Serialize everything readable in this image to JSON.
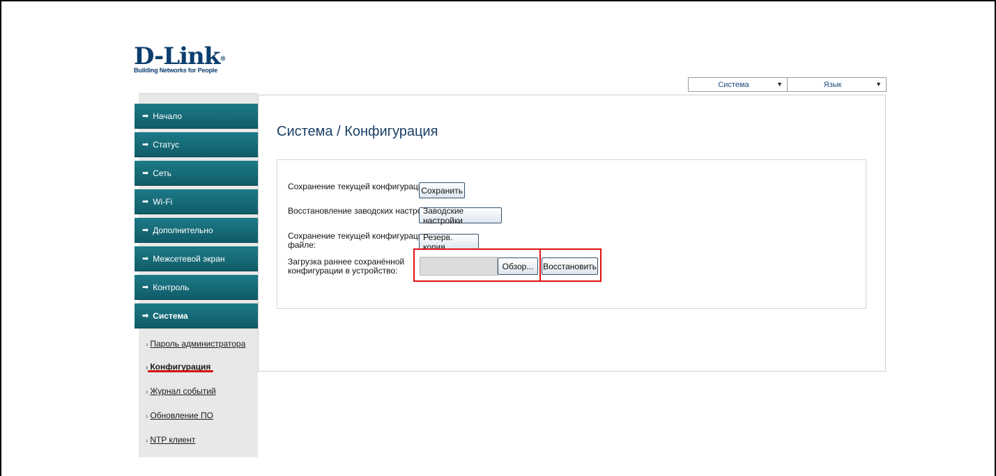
{
  "brand": {
    "name": "D-Link",
    "tagline": "Building Networks for People",
    "registered": "®"
  },
  "top_selects": [
    {
      "label": "Система",
      "arrow": "▼"
    },
    {
      "label": "Язык",
      "arrow": "▼"
    }
  ],
  "sidebar": {
    "items": [
      {
        "label": "Начало"
      },
      {
        "label": "Статус"
      },
      {
        "label": "Сеть"
      },
      {
        "label": "Wi-Fi"
      },
      {
        "label": "Дополнительно"
      },
      {
        "label": "Межсетевой экран"
      },
      {
        "label": "Контроль"
      },
      {
        "label": "Система",
        "active": true
      }
    ],
    "subitems": [
      {
        "label": "Пароль администратора"
      },
      {
        "label": "Конфигурация",
        "active": true
      },
      {
        "label": "Журнал событий"
      },
      {
        "label": "Обновление ПО"
      },
      {
        "label": "NTP клиент"
      }
    ]
  },
  "page": {
    "title": "Система  / Конфигурация",
    "rows": {
      "save_label": "Сохранение текущей конфигурации:",
      "save_button": "Сохранить",
      "factory_label": "Восстановление заводских настроек:",
      "factory_button": "Заводские настройки",
      "backup_label_line1": "Сохранение текущей конфигурации в",
      "backup_label_line2": "файле:",
      "backup_button": "Резерв. копия",
      "restore_label_line1": "Загрузка раннее сохранённой",
      "restore_label_line2": "конфигурации в устройство:",
      "browse_button": "Обзор...",
      "restore_button": "Восстановить",
      "file_value": ""
    }
  },
  "colors": {
    "menu_bg": "#126b77",
    "highlight": "#e01010",
    "title": "#1a3f66"
  }
}
